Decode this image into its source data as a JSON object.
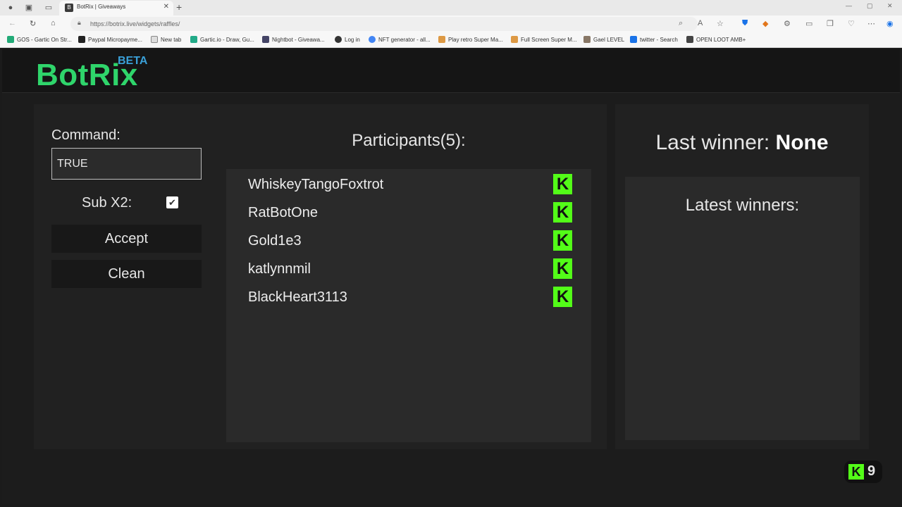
{
  "browser": {
    "tab_title": "BotRix | Giveaways",
    "url": "https://botrix.live/widgets/raffles/",
    "bookmarks": [
      "GOS - Gartic On Str...",
      "Paypal Micropayme...",
      "New tab",
      "Gartic.io - Draw, Gu...",
      "Nightbot - Giveawa...",
      "Log in",
      "NFT generator - all...",
      "Play retro Super Ma...",
      "Full Screen Super M...",
      "Gael LEVEL",
      "twitter - Search",
      "OPEN LOOT AMB+"
    ]
  },
  "header": {
    "logo": "BotRix",
    "beta": "BETA"
  },
  "controls": {
    "command_label": "Command:",
    "command_value": "TRUE",
    "sub_label": "Sub X2:",
    "sub_checked": true,
    "accept_label": "Accept",
    "clean_label": "Clean"
  },
  "participants": {
    "title": "Participants(5):",
    "list": [
      {
        "name": "WhiskeyTangoFoxtrot"
      },
      {
        "name": "RatBotOne"
      },
      {
        "name": "Gold1e3"
      },
      {
        "name": "katlynnmil"
      },
      {
        "name": "BlackHeart3113"
      }
    ]
  },
  "winner": {
    "last_label": "Last winner:",
    "last_value": "None",
    "latest_title": "Latest winners:"
  },
  "kick_badge": {
    "letter": "K",
    "count": "9"
  },
  "colors": {
    "brand_green": "#2fd56b",
    "beta_blue": "#3aa0d8",
    "kick_green": "#53fc18"
  }
}
